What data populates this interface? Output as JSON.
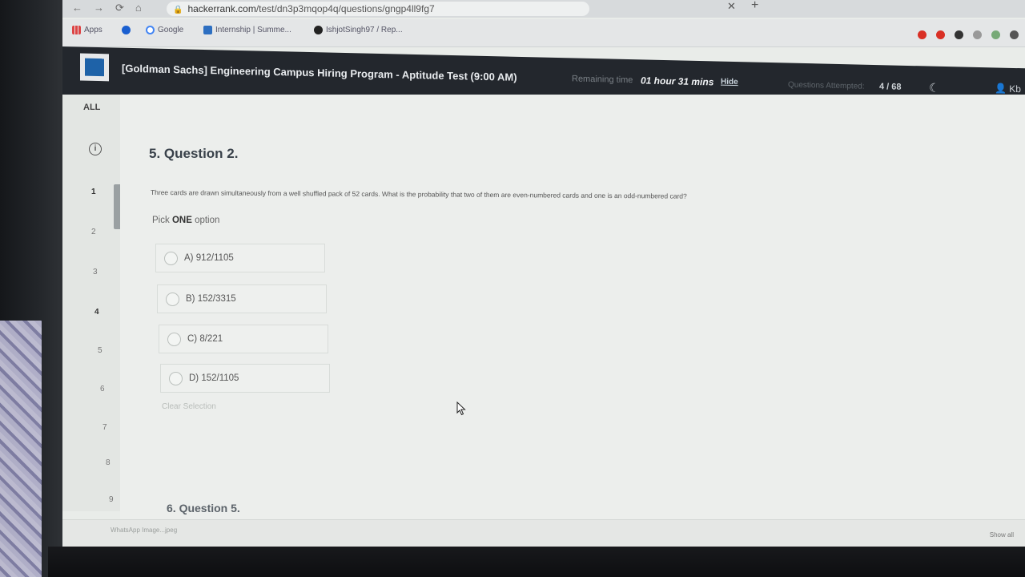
{
  "browser": {
    "url_host": "hackerrank.com",
    "url_path": "/test/dn3p3mqop4q/questions/gngp4ll9fg7",
    "bookmarks": [
      "Apps",
      "Google",
      "Internship | Summe...",
      "IshjotSingh97 / Rep..."
    ]
  },
  "header": {
    "test_title": "[Goldman Sachs] Engineering Campus Hiring Program - Aptitude Test (9:00 AM)",
    "remaining_label": "Remaining time",
    "remaining_value": "01 hour 31 mins",
    "hide_label": "Hide",
    "attempted_label": "Questions Attempted:",
    "attempted_value": "4 / 68",
    "user": "Kb"
  },
  "sidebar": {
    "all_label": "ALL",
    "question_numbers": [
      "1",
      "2",
      "3",
      "4",
      "5",
      "6",
      "7",
      "8",
      "9"
    ]
  },
  "question": {
    "heading": "5. Question 2.",
    "text": "Three cards are drawn simultaneously from a well shuffled pack of 52 cards. What is the probability that two of them are even-numbered cards and one is an odd-numbered card?",
    "pick_prefix": "Pick",
    "pick_bold": "ONE",
    "pick_suffix": "option",
    "options": [
      "A) 912/1105",
      "B) 152/3315",
      "C) 8/221",
      "D) 152/1105"
    ],
    "clear_selection": "Clear Selection"
  },
  "next_question": {
    "heading": "6. Question 5."
  },
  "downloads": {
    "item": "WhatsApp Image...jpeg",
    "show_all": "Show all"
  },
  "colors": {
    "header_bg": "#23272d",
    "logo_blue": "#1e62a8",
    "page_bg": "#eceeec"
  }
}
